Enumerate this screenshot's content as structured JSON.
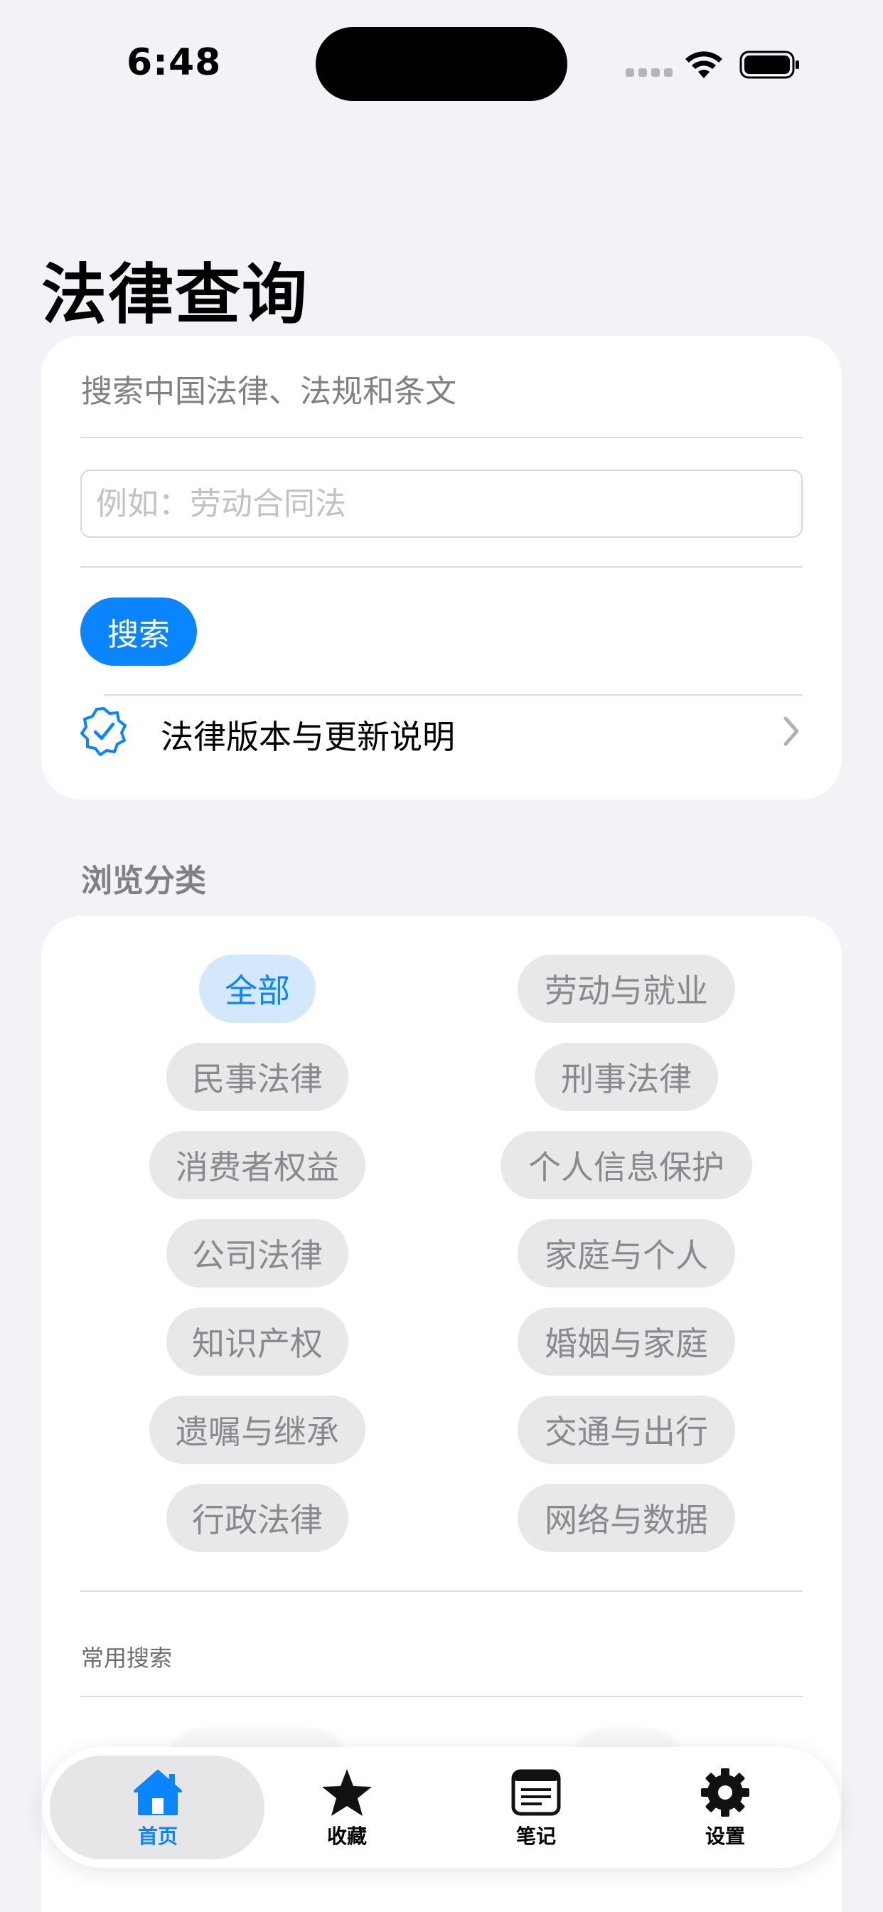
{
  "status_bar": {
    "time": "6:48"
  },
  "page": {
    "title": "法律查询"
  },
  "search": {
    "description": "搜索中国法律、法规和条文",
    "placeholder": "例如：劳动合同法",
    "value": "",
    "button_label": "搜索"
  },
  "version_row": {
    "label": "法律版本与更新说明"
  },
  "browse": {
    "header": "浏览分类",
    "categories": [
      {
        "label": "全部",
        "selected": true
      },
      {
        "label": "劳动与就业",
        "selected": false
      },
      {
        "label": "民事法律",
        "selected": false
      },
      {
        "label": "刑事法律",
        "selected": false
      },
      {
        "label": "消费者权益",
        "selected": false
      },
      {
        "label": "个人信息保护",
        "selected": false
      },
      {
        "label": "公司法律",
        "selected": false
      },
      {
        "label": "家庭与个人",
        "selected": false
      },
      {
        "label": "知识产权",
        "selected": false
      },
      {
        "label": "婚姻与家庭",
        "selected": false
      },
      {
        "label": "遗嘱与继承",
        "selected": false
      },
      {
        "label": "交通与出行",
        "selected": false
      },
      {
        "label": "行政法律",
        "selected": false
      },
      {
        "label": "网络与数据",
        "selected": false
      }
    ]
  },
  "common_searches": {
    "header": "常用搜索"
  },
  "tab_bar": {
    "items": [
      {
        "label": "首页",
        "icon": "house-icon",
        "active": true
      },
      {
        "label": "收藏",
        "icon": "star-icon",
        "active": false
      },
      {
        "label": "笔记",
        "icon": "notes-icon",
        "active": false
      },
      {
        "label": "设置",
        "icon": "gear-icon",
        "active": false
      }
    ]
  },
  "colors": {
    "accent": "#0a84ff",
    "background": "#f2f2f7",
    "chip_background": "#e8e8ea",
    "chip_selected_background": "#d3e9fb",
    "chip_text": "#8a8a8e"
  }
}
